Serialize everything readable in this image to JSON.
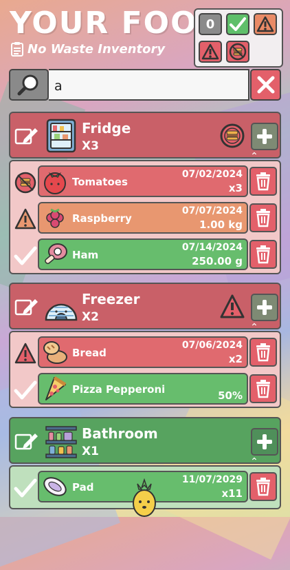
{
  "header": {
    "title": "YOUR FOOD",
    "subtitle": "No Waste Inventory"
  },
  "filters": {
    "count": "0",
    "icons": [
      "check-icon",
      "warning-icon",
      "danger-icon",
      "expired-icon"
    ]
  },
  "search": {
    "value": "a",
    "placeholder": ""
  },
  "colors": {
    "red_section": "#c96068",
    "green_section": "#57a35f",
    "expired": "#e06a6f",
    "warning": "#e89770",
    "ok": "#67bd6d"
  },
  "sections": [
    {
      "name": "Fridge",
      "count": "X3",
      "icon": "fridge-icon",
      "status_icon": "expired-icon",
      "items": [
        {
          "name": "Tomatoes",
          "date": "07/02/2024",
          "qty": "x3",
          "status": "expired",
          "icon": "tomato-icon"
        },
        {
          "name": "Raspberry",
          "date": "07/07/2024",
          "qty": "1.00 kg",
          "status": "warning",
          "icon": "raspberry-icon"
        },
        {
          "name": "Ham",
          "date": "07/14/2024",
          "qty": "250.00 g",
          "status": "ok",
          "icon": "ham-icon"
        }
      ]
    },
    {
      "name": "Freezer",
      "count": "X2",
      "icon": "igloo-icon",
      "status_icon": "danger-icon",
      "items": [
        {
          "name": "Bread",
          "date": "07/06/2024",
          "qty": "x2",
          "status": "danger",
          "icon": "bread-icon"
        },
        {
          "name": "Pizza Pepperoni",
          "date": "",
          "qty": "50%",
          "status": "ok",
          "icon": "pizza-icon"
        }
      ]
    },
    {
      "name": "Bathroom",
      "count": "X1",
      "icon": "shelf-icon",
      "status_icon": "",
      "items": [
        {
          "name": "Pad",
          "date": "11/07/2029",
          "qty": "x11",
          "status": "ok",
          "icon": "pad-icon"
        }
      ]
    }
  ]
}
